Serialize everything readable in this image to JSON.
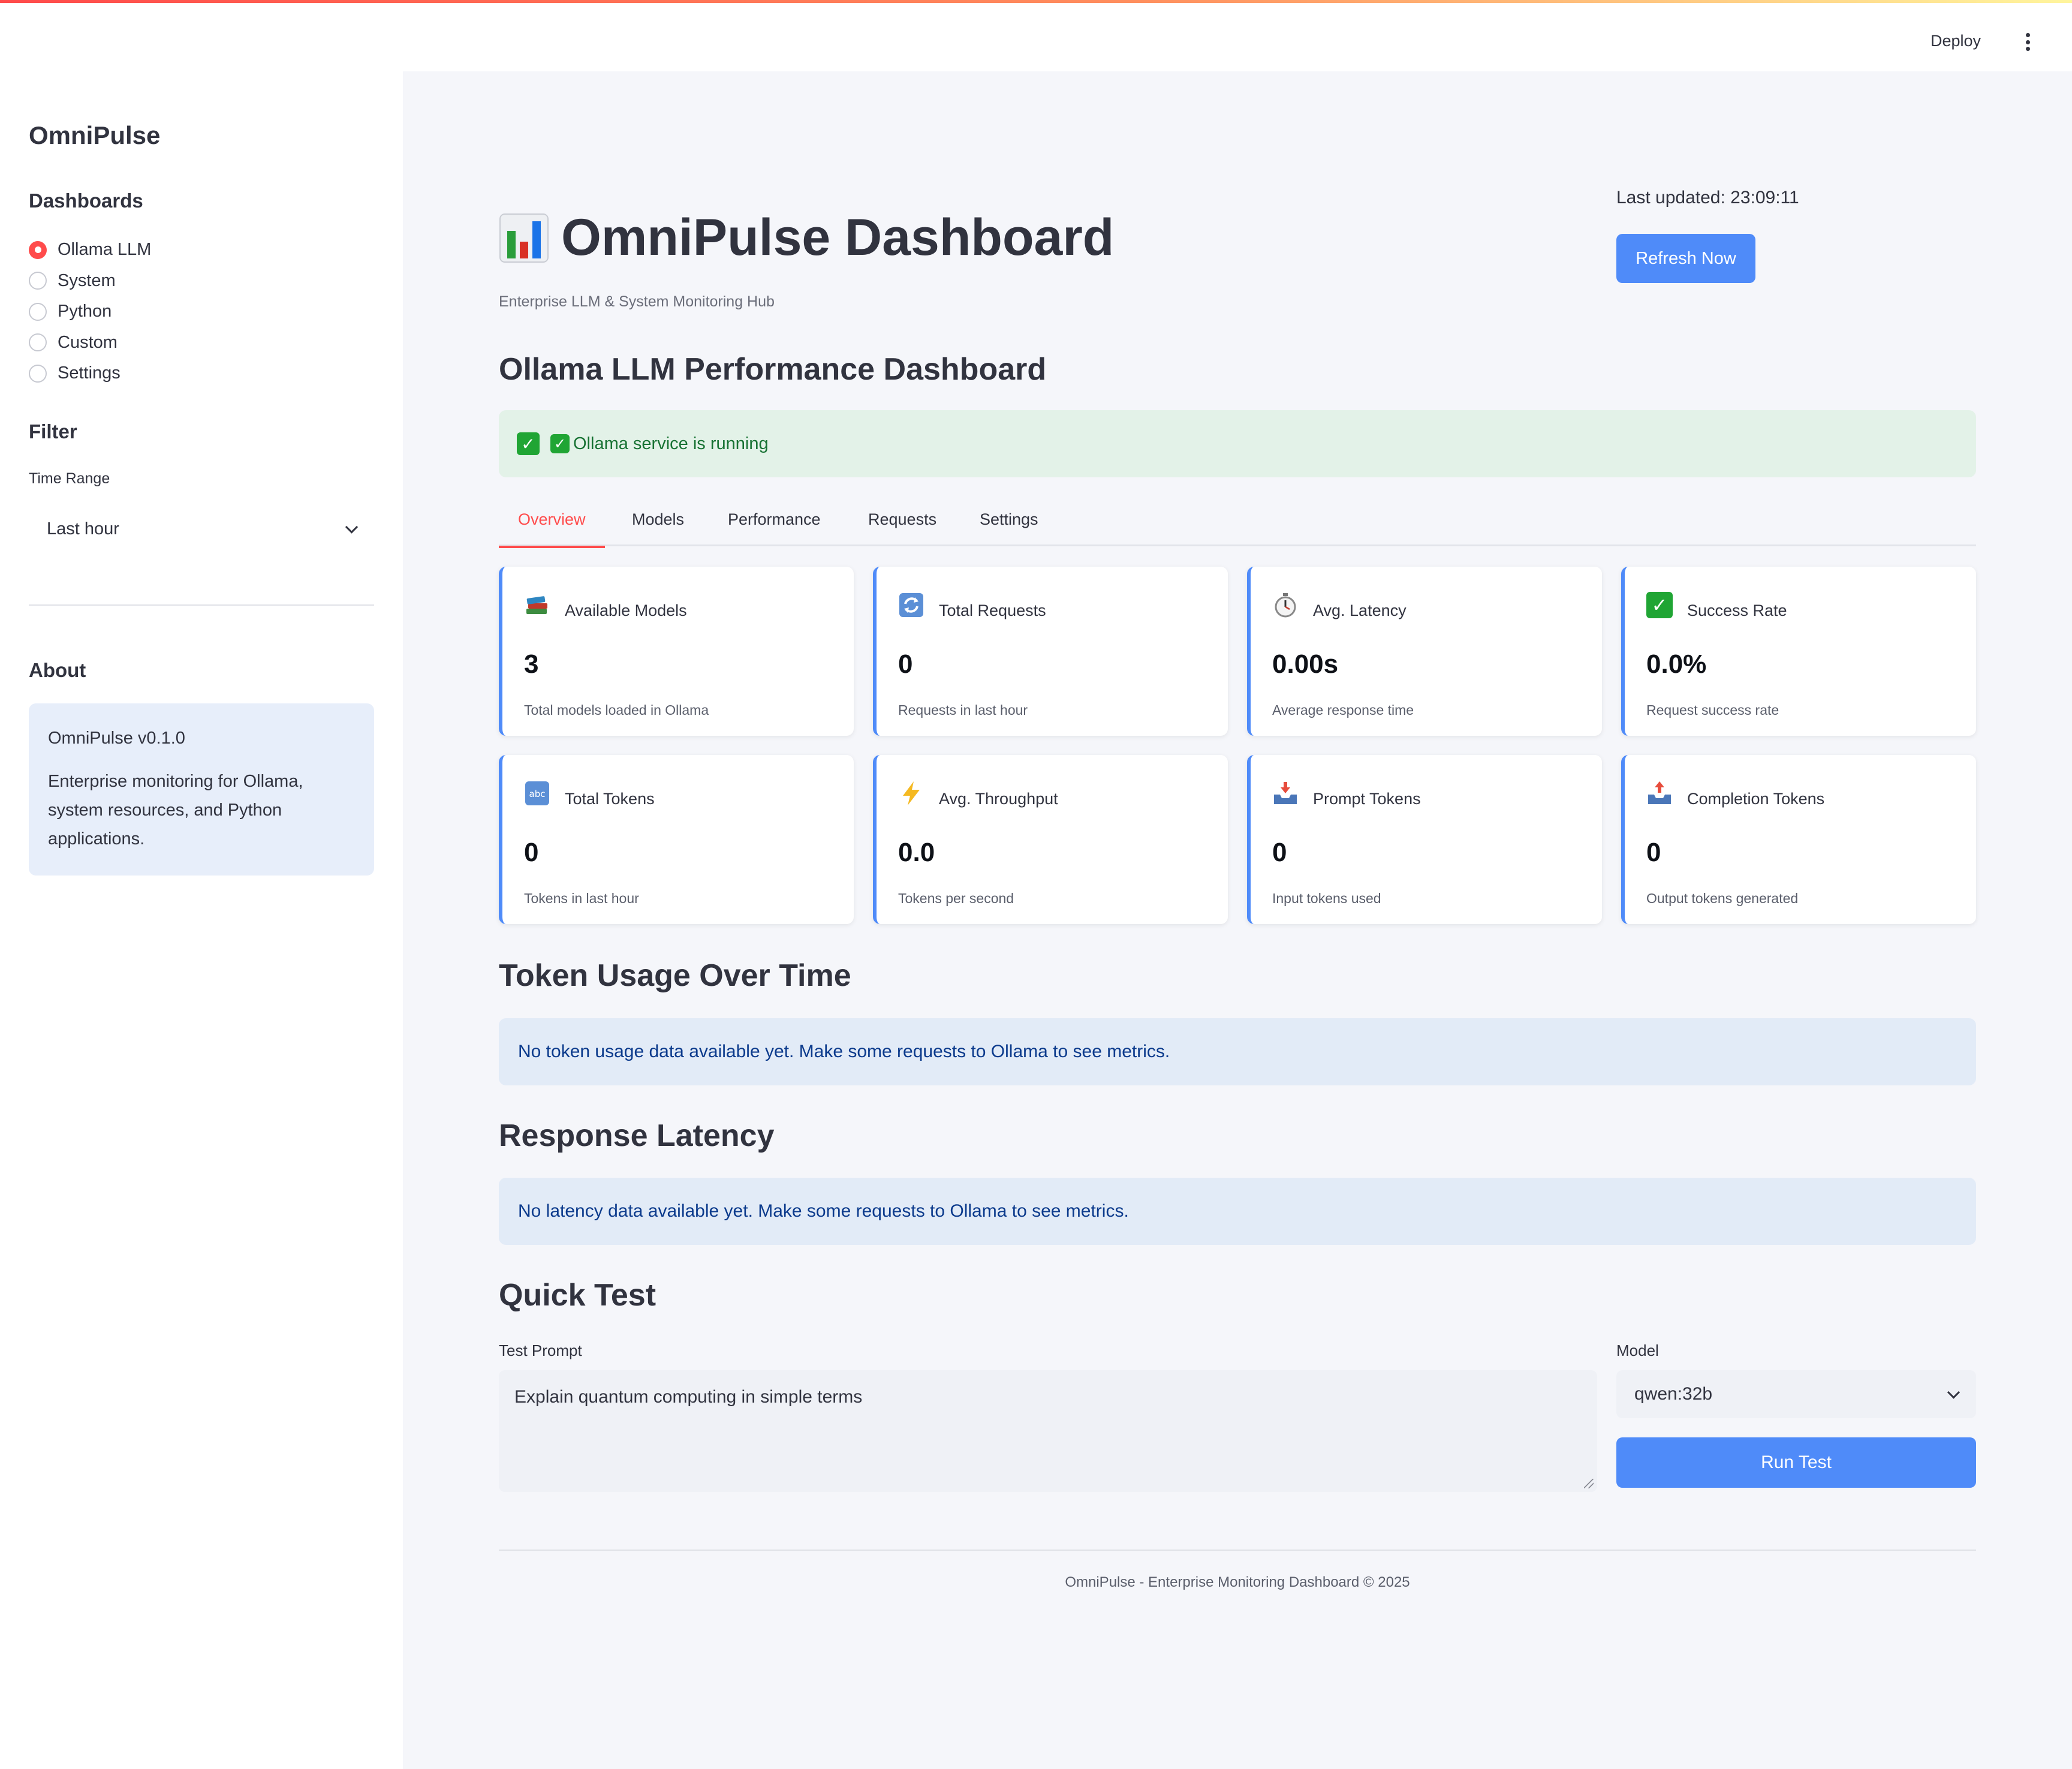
{
  "header": {
    "deploy_label": "Deploy"
  },
  "sidebar": {
    "title": "OmniPulse",
    "dashboards_heading": "Dashboards",
    "items": [
      {
        "label": "Ollama LLM",
        "selected": true
      },
      {
        "label": "System",
        "selected": false
      },
      {
        "label": "Python",
        "selected": false
      },
      {
        "label": "Custom",
        "selected": false
      },
      {
        "label": "Settings",
        "selected": false
      }
    ],
    "filter_heading": "Filter",
    "time_range_label": "Time Range",
    "time_range_value": "Last hour",
    "about_heading": "About",
    "about_version": "OmniPulse v0.1.0",
    "about_text": "Enterprise monitoring for Ollama, system resources, and Python applications."
  },
  "main": {
    "title": "OmniPulse Dashboard",
    "subtitle": "Enterprise LLM & System Monitoring Hub",
    "last_updated": "Last updated: 23:09:11",
    "refresh_label": "Refresh Now",
    "section_title": "Ollama LLM Performance Dashboard",
    "status_text": "Ollama service is running",
    "tabs": [
      "Overview",
      "Models",
      "Performance",
      "Requests",
      "Settings"
    ],
    "active_tab": "Overview",
    "cards": [
      {
        "icon": "books-icon",
        "label": "Available Models",
        "value": "3",
        "desc": "Total models loaded in Ollama"
      },
      {
        "icon": "refresh-icon",
        "label": "Total Requests",
        "value": "0",
        "desc": "Requests in last hour"
      },
      {
        "icon": "stopwatch-icon",
        "label": "Avg. Latency",
        "value": "0.00s",
        "desc": "Average response time"
      },
      {
        "icon": "check-icon",
        "label": "Success Rate",
        "value": "0.0%",
        "desc": "Request success rate"
      },
      {
        "icon": "abc-icon",
        "label": "Total Tokens",
        "value": "0",
        "desc": "Tokens in last hour"
      },
      {
        "icon": "lightning-icon",
        "label": "Avg. Throughput",
        "value": "0.0",
        "desc": "Tokens per second"
      },
      {
        "icon": "inbox-tray-icon",
        "label": "Prompt Tokens",
        "value": "0",
        "desc": "Input tokens used"
      },
      {
        "icon": "outbox-tray-icon",
        "label": "Completion Tokens",
        "value": "0",
        "desc": "Output tokens generated"
      }
    ],
    "token_usage_title": "Token Usage Over Time",
    "token_usage_info": "No token usage data available yet. Make some requests to Ollama to see metrics.",
    "latency_title": "Response Latency",
    "latency_info": "No latency data available yet. Make some requests to Ollama to see metrics.",
    "quick_test_title": "Quick Test",
    "test_prompt_label": "Test Prompt",
    "test_prompt_value": "Explain quantum computing in simple terms",
    "model_label": "Model",
    "model_value": "qwen:32b",
    "run_label": "Run Test",
    "footer": "OmniPulse - Enterprise Monitoring Dashboard © 2025"
  },
  "colors": {
    "accent": "#ff4b4b",
    "primary_button": "#4f8bf9",
    "success_bg": "#e3f2e8",
    "info_bg": "#e2ebf7"
  }
}
